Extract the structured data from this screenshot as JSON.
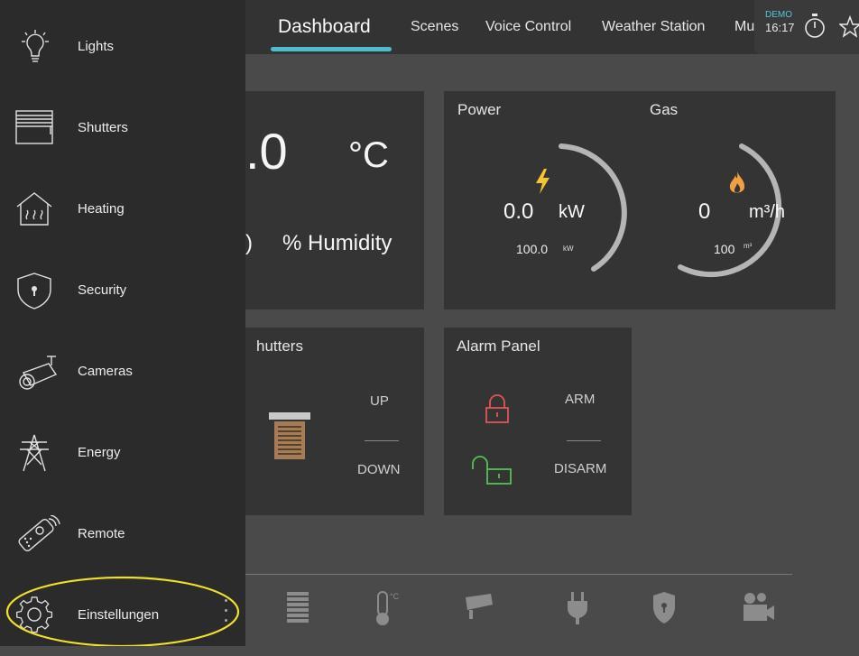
{
  "header": {
    "tabs": [
      {
        "label": "Dashboard",
        "active": true
      },
      {
        "label": "Scenes"
      },
      {
        "label": "Voice Control"
      },
      {
        "label": "Weather Station"
      },
      {
        "label": "Mu"
      }
    ],
    "demo_badge": "DEMO",
    "time": "16:17",
    "accent_color": "#4dbbd2"
  },
  "climate": {
    "temperature": ".0",
    "temperature_unit": "°C",
    "humidity_value": ")",
    "humidity_label": "% Humidity"
  },
  "energy": {
    "power": {
      "title": "Power",
      "value": "0.0",
      "unit": "kW",
      "max": "100.0",
      "max_unit": "kW",
      "icon": "lightning-icon",
      "icon_color": "#f3c531"
    },
    "gas": {
      "title": "Gas",
      "value": "0",
      "unit": "m³/h",
      "max": "100",
      "max_unit": "m³",
      "icon": "flame-icon",
      "icon_color": "#f0a040"
    }
  },
  "shutters": {
    "title": "hutters",
    "up_label": "UP",
    "down_label": "DOWN"
  },
  "alarm": {
    "title": "Alarm Panel",
    "arm_label": "ARM",
    "disarm_label": "DISARM",
    "arm_color": "#e05555",
    "disarm_color": "#55c055"
  },
  "sidebar": {
    "items": [
      {
        "label": "Lights",
        "icon": "lightbulb-icon"
      },
      {
        "label": "Shutters",
        "icon": "shutters-icon"
      },
      {
        "label": "Heating",
        "icon": "heating-icon"
      },
      {
        "label": "Security",
        "icon": "shield-icon"
      },
      {
        "label": "Cameras",
        "icon": "camera-icon"
      },
      {
        "label": "Energy",
        "icon": "power-pylon-icon"
      },
      {
        "label": "Remote",
        "icon": "remote-icon"
      },
      {
        "label": "Einstellungen",
        "icon": "gear-icon"
      }
    ],
    "highlight_color": "#f1e02a"
  },
  "dock": {
    "icons": [
      "shutters-icon",
      "thermometer-icon",
      "camera-icon",
      "plug-icon",
      "shield-icon",
      "video-icon"
    ]
  }
}
